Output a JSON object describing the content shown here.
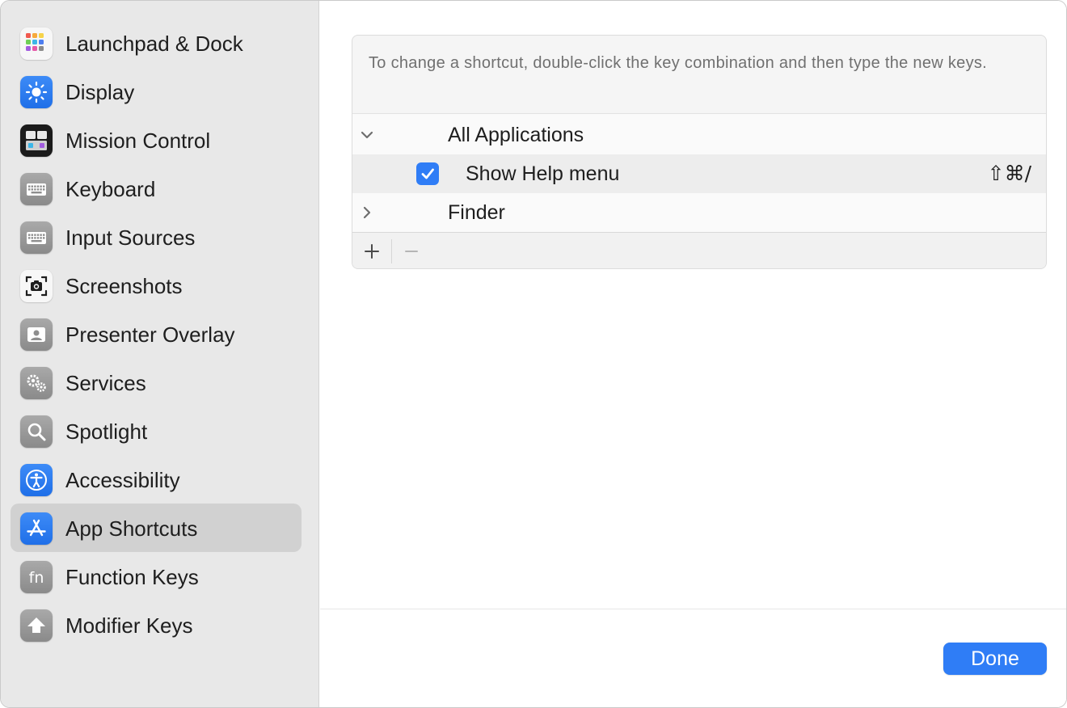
{
  "sidebar": {
    "items": [
      {
        "label": "Launchpad & Dock",
        "icon": "launchpad-icon"
      },
      {
        "label": "Display",
        "icon": "display-icon"
      },
      {
        "label": "Mission Control",
        "icon": "mission-control-icon"
      },
      {
        "label": "Keyboard",
        "icon": "keyboard-icon"
      },
      {
        "label": "Input Sources",
        "icon": "input-sources-icon"
      },
      {
        "label": "Screenshots",
        "icon": "screenshots-icon"
      },
      {
        "label": "Presenter Overlay",
        "icon": "presenter-overlay-icon"
      },
      {
        "label": "Services",
        "icon": "services-icon"
      },
      {
        "label": "Spotlight",
        "icon": "spotlight-icon"
      },
      {
        "label": "Accessibility",
        "icon": "accessibility-icon"
      },
      {
        "label": "App Shortcuts",
        "icon": "app-shortcuts-icon",
        "selected": true
      },
      {
        "label": "Function Keys",
        "icon": "function-keys-icon"
      },
      {
        "label": "Modifier Keys",
        "icon": "modifier-keys-icon"
      }
    ]
  },
  "main": {
    "hint": "To change a shortcut, double-click the key combination and then type the new keys.",
    "groups": [
      {
        "label": "All Applications",
        "expanded": true,
        "items": [
          {
            "label": "Show Help menu",
            "checked": true,
            "shortcut": "⇧⌘/"
          }
        ]
      },
      {
        "label": "Finder",
        "expanded": false
      }
    ],
    "toolbar": {
      "add": "+",
      "remove": "−"
    },
    "done_label": "Done"
  },
  "colors": {
    "accent": "#2f7df6",
    "sidebar_bg": "#e8e8e8",
    "selected_bg": "#d1d1d1"
  }
}
